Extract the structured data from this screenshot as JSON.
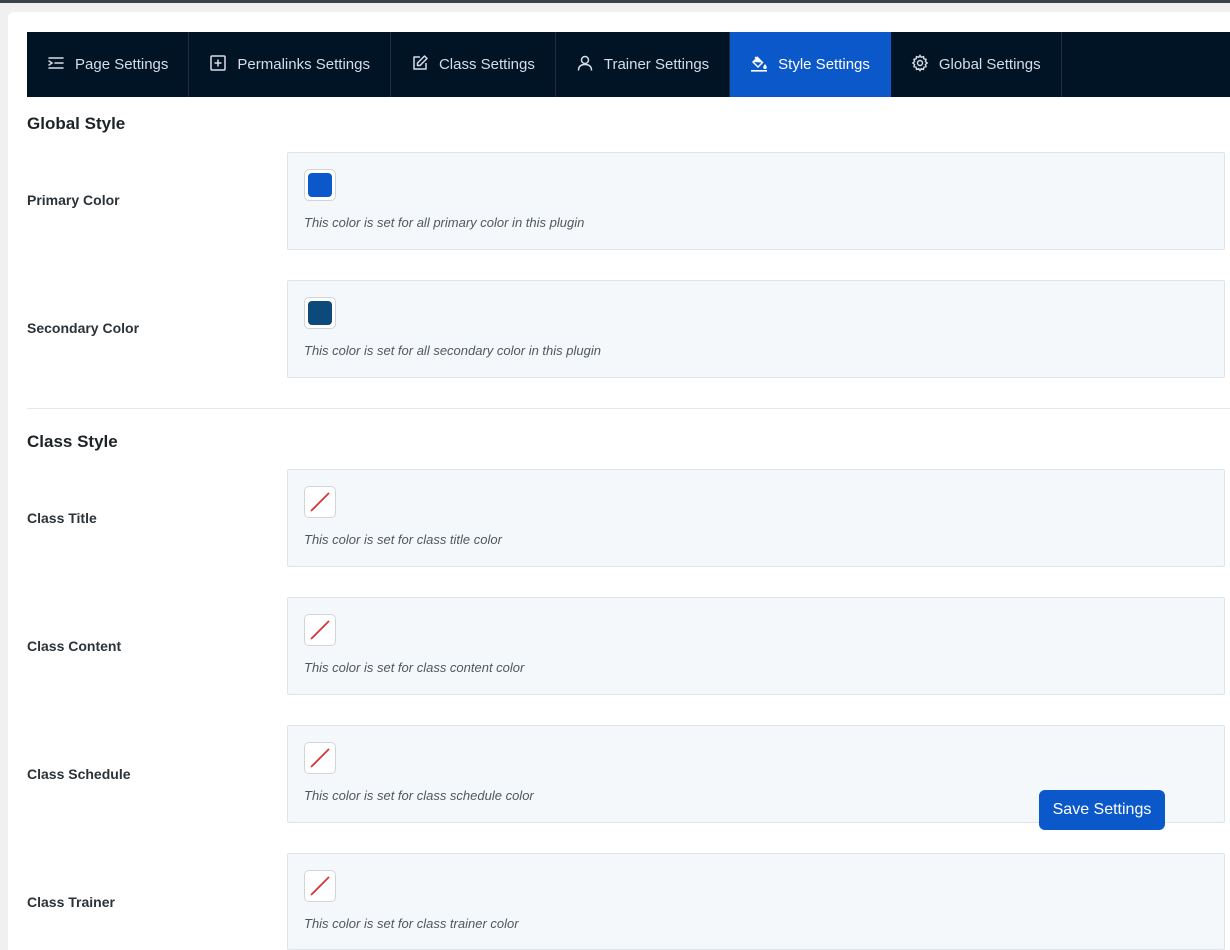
{
  "tabs": [
    {
      "label": "Page Settings",
      "icon": "indent-list-icon",
      "active": false
    },
    {
      "label": "Permalinks Settings",
      "icon": "plus-square-icon",
      "active": false
    },
    {
      "label": "Class Settings",
      "icon": "edit-icon",
      "active": false
    },
    {
      "label": "Trainer Settings",
      "icon": "user-icon",
      "active": false
    },
    {
      "label": "Style Settings",
      "icon": "paint-bucket-icon",
      "active": true
    },
    {
      "label": "Global Settings",
      "icon": "gear-icon",
      "active": false
    }
  ],
  "global_style": {
    "title": "Global Style",
    "fields": [
      {
        "label": "Primary Color",
        "color": "#0a58ca",
        "description": "This color is set for all primary color in this plugin"
      },
      {
        "label": "Secondary Color",
        "color": "#0b4a7a",
        "description": "This color is set for all secondary color in this plugin"
      }
    ]
  },
  "class_style": {
    "title": "Class Style",
    "fields": [
      {
        "label": "Class Title",
        "color": null,
        "description": "This color is set for class title color"
      },
      {
        "label": "Class Content",
        "color": null,
        "description": "This color is set for class content color"
      },
      {
        "label": "Class Schedule",
        "color": null,
        "description": "This color is set for class schedule color"
      },
      {
        "label": "Class Trainer",
        "color": null,
        "description": "This color is set for class trainer color"
      }
    ]
  },
  "save_button": {
    "label": "Save Settings"
  },
  "colors": {
    "nav_bg": "#001426",
    "accent": "#0a58ca",
    "empty_swatch_slash": "#d63638"
  }
}
